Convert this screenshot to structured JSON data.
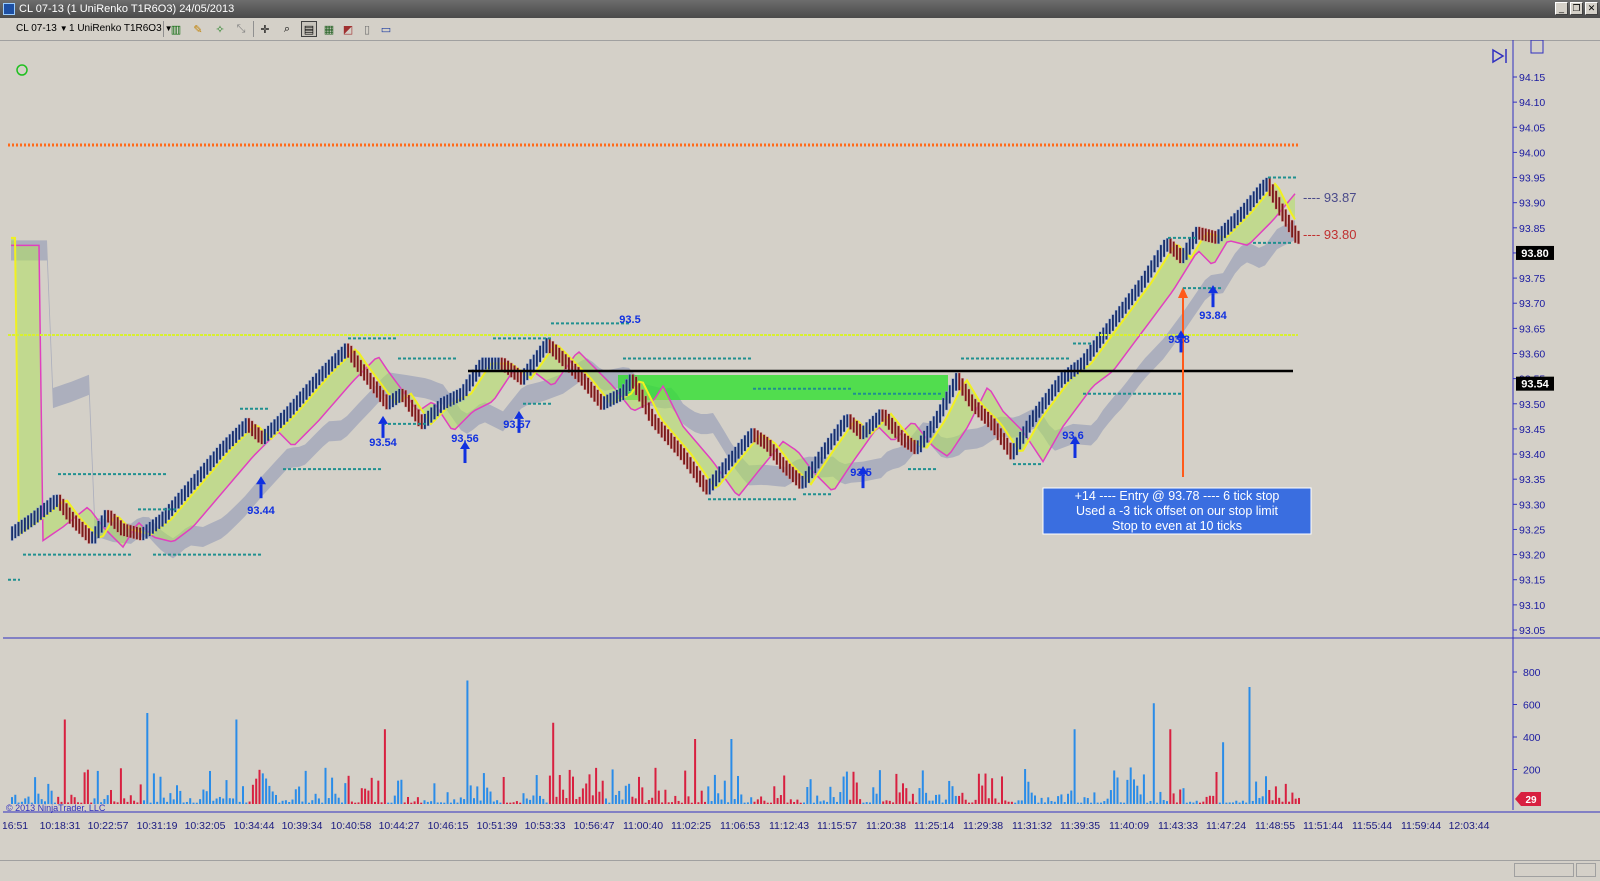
{
  "window": {
    "title": "CL 07-13 (1 UniRenko T1R6O3)  24/05/2013",
    "buttons": [
      "_",
      "❐",
      "✕"
    ]
  },
  "toolbar": {
    "instrument": "CL 07-13",
    "interval": "1 UniRenko T1R6O3",
    "icons": [
      "bar-type-icon",
      "pencil-draw-icon",
      "magic-wand-icon",
      "crosshair-tool-icon",
      "crosshair-move-icon",
      "zoom-icon",
      "chart-properties-icon",
      "indicators-icon",
      "strategies-icon",
      "data-box-icon",
      "order-panel-icon"
    ]
  },
  "chart": {
    "copyright": "© 2013 NinjaTrader, LLC",
    "price_ticks": [
      "94.15",
      "94.10",
      "94.05",
      "94.00",
      "93.95",
      "93.90",
      "93.85",
      "93.80",
      "93.75",
      "93.70",
      "93.65",
      "93.60",
      "93.55",
      "93.50",
      "93.45",
      "93.40",
      "93.35",
      "93.30",
      "93.25",
      "93.20",
      "93.15",
      "93.10",
      "93.05"
    ],
    "volume_ticks": [
      "800",
      "600",
      "400",
      "200"
    ],
    "time_labels": [
      "16:51",
      "10:18:31",
      "10:22:57",
      "10:31:19",
      "10:32:05",
      "10:34:44",
      "10:39:34",
      "10:40:58",
      "10:44:27",
      "10:46:15",
      "10:51:39",
      "10:53:33",
      "10:56:47",
      "11:00:40",
      "11:02:25",
      "11:06:53",
      "11:12:43",
      "11:15:57",
      "11:20:38",
      "11:25:14",
      "11:29:38",
      "11:31:32",
      "11:39:35",
      "11:40:09",
      "11:43:33",
      "11:47:24",
      "11:48:55",
      "11:51:44",
      "11:55:44",
      "11:59:44",
      "12:03:44"
    ],
    "current_price_box": "93.80",
    "line_price_box": "93.54",
    "volume_box": "29",
    "right_labels": [
      {
        "text": "---- 93.87",
        "color": "#4a4a8a"
      },
      {
        "text": "---- 93.80",
        "color": "#c03030"
      }
    ],
    "signal_labels": [
      "93.44",
      "93.54",
      "93.56",
      "93.57",
      "93.5",
      "93.5",
      "93.6",
      "93.8",
      "93.84"
    ],
    "trade_note": {
      "line1": "+14 ---- Entry @ 93.78 ---- 6 tick stop",
      "line2": "Used a -3 tick offset on our stop limit",
      "line3": "Stop to even at 10 ticks"
    },
    "colors": {
      "background": "#d4d0c8",
      "up_bar": "#1a2f6b",
      "down_bar": "#7a1a1a",
      "orange_line": "#ff6a1a",
      "yellow_line": "#d8f030",
      "axis_text": "#1a1aa0",
      "volume_up": "#2a8ce8",
      "volume_down": "#d82040",
      "note_bg": "#3a6ee0"
    }
  }
}
